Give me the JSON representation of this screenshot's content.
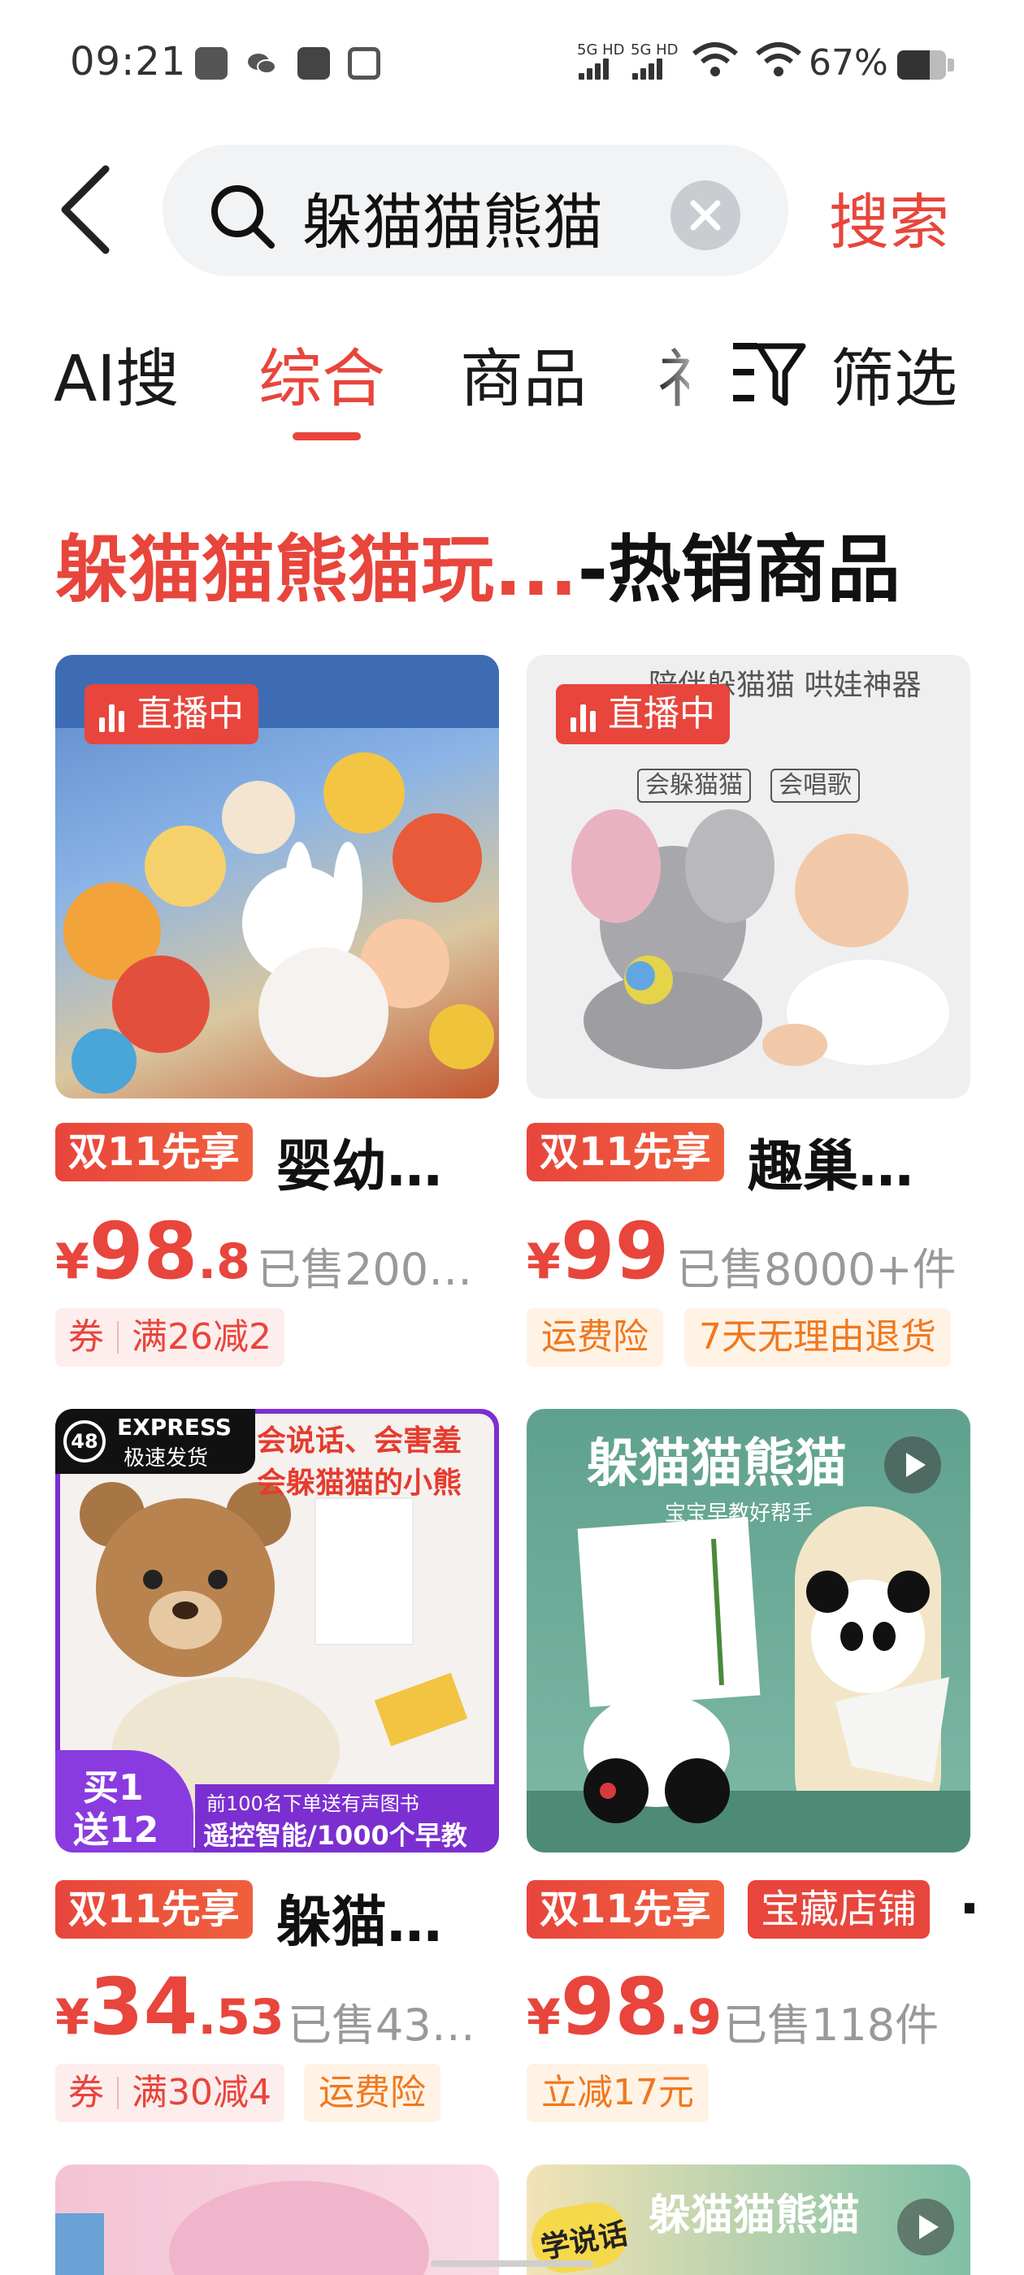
{
  "status_bar": {
    "time": "09:21",
    "network1": "5G HD",
    "network2": "5G HD",
    "battery": "67%",
    "battery_level": 0.67
  },
  "search": {
    "query": "躲猫猫熊猫",
    "button": "搜索"
  },
  "tabs": [
    {
      "label": "AI搜",
      "active": false
    },
    {
      "label": "综合",
      "active": true
    },
    {
      "label": "商品",
      "active": false
    },
    {
      "label": "礻",
      "active": false
    }
  ],
  "filter_label": "筛选",
  "section": {
    "title_keyword": "躲猫猫熊猫玩...",
    "title_suffix": "-热销商品"
  },
  "products": [
    {
      "live_badge": "直播中",
      "promo": "双11先享",
      "title": "婴幼…",
      "price_currency": "¥",
      "price_int": "98",
      "price_dec": ".8",
      "sold": "已售200…",
      "coupon_label": "券",
      "coupon_value": "满26减2"
    },
    {
      "live_badge": "直播中",
      "promo": "双11先享",
      "title": "趣巢…",
      "price_currency": "¥",
      "price_int": "99",
      "sold": "已售8000+件",
      "tags": [
        "运费险",
        "7天无理由退货"
      ],
      "image_text": {
        "headline": "陪伴躲猫猫 哄娃神器",
        "chip1": "会躲猫猫",
        "chip2": "会唱歌"
      }
    },
    {
      "promo": "双11先享",
      "title": "躲猫…",
      "price_currency": "¥",
      "price_int": "34",
      "price_dec": ".53",
      "sold": "已售43…",
      "coupon_label": "券",
      "coupon_value": "满30减4",
      "tags": [
        "运费险"
      ],
      "image_text": {
        "express_num": "48",
        "express_en": "EXPRESS",
        "express_cn": "极速发货",
        "headline1": "会说话、会害羞",
        "headline2": "会躲猫猫的小熊",
        "offer_line1": "买1",
        "offer_line2": "送12",
        "bottom_small": "前100名下单送有声图书",
        "bottom_big": "遥控智能/1000个早教"
      }
    },
    {
      "promo": "双11先享",
      "promo2": "宝藏店铺",
      "title": "·",
      "price_currency": "¥",
      "price_int": "98",
      "price_dec": ".9",
      "sold": "已售118件",
      "tags": [
        "立减17元"
      ],
      "image_text": {
        "headline": "躲猫猫熊猫",
        "sub": "宝宝早教好帮手"
      }
    }
  ],
  "partial_cards": [
    {},
    {
      "image_text": {
        "badge": "学说话",
        "headline": "躲猫猫熊猫"
      }
    }
  ],
  "colors": {
    "accent": "#e8453c",
    "coupon_bg": "#fdeeed",
    "tag_bg": "#fff3e6",
    "tag_text": "#f0781e",
    "search_bg": "#f2f3f5"
  }
}
